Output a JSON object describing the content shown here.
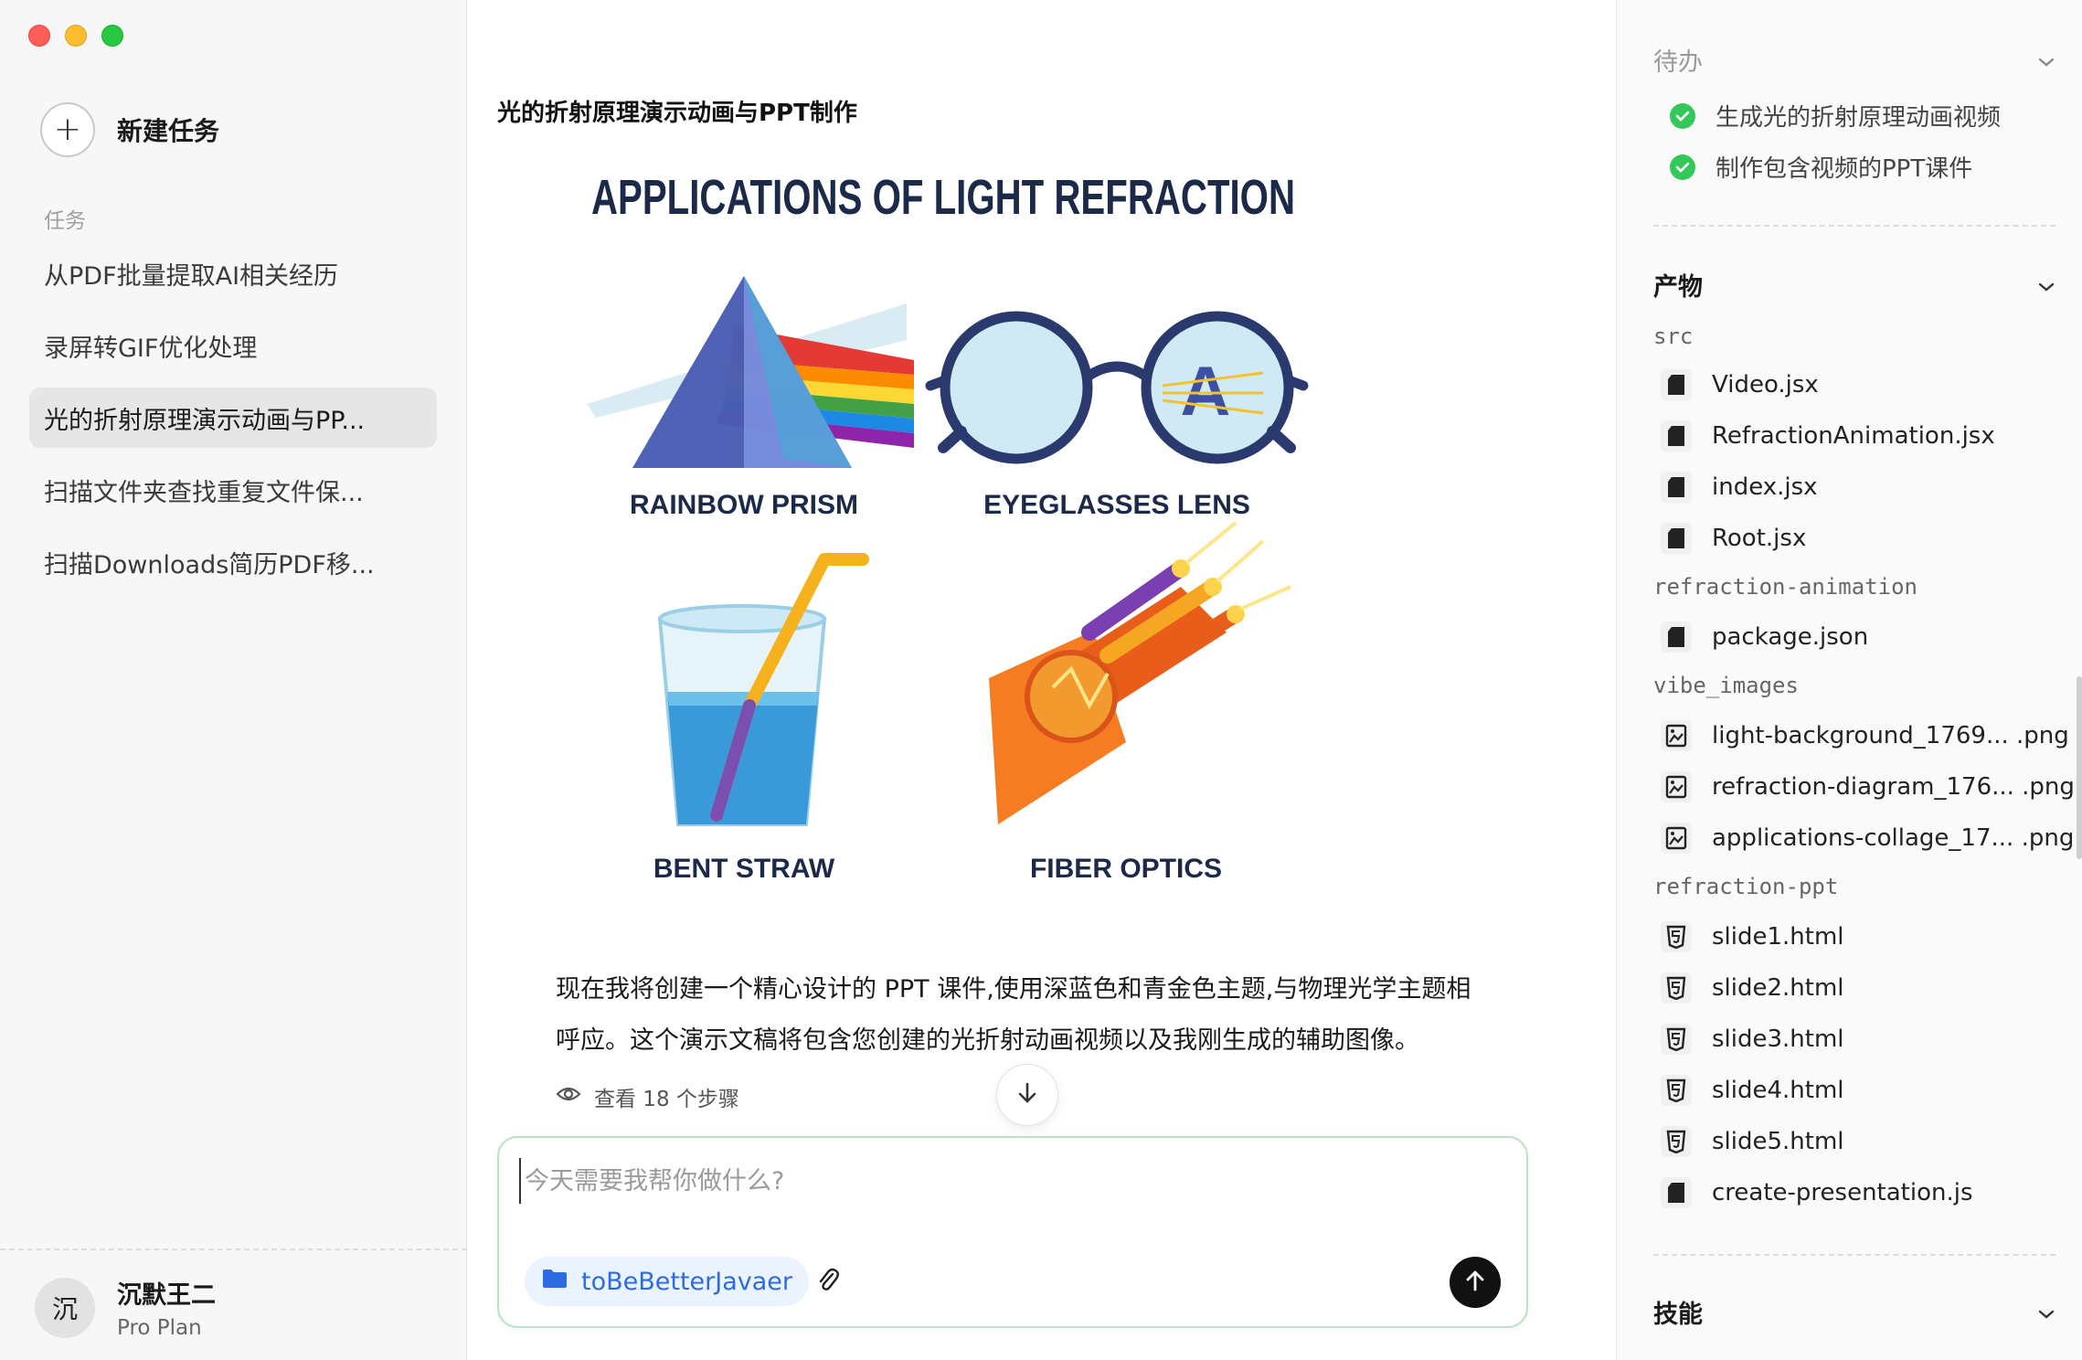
{
  "sidebar": {
    "new_task_label": "新建任务",
    "tasks_title": "任务",
    "tasks": [
      {
        "label": "从PDF批量提取AI相关经历"
      },
      {
        "label": "录屏转GIF优化处理"
      },
      {
        "label": "光的折射原理演示动画与PP..."
      },
      {
        "label": "扫描文件夹查找重复文件保..."
      },
      {
        "label": "扫描Downloads简历PDF移..."
      }
    ],
    "active_task_index": 2,
    "user": {
      "avatar_char": "沉",
      "name": "沉默王二",
      "plan": "Pro Plan"
    }
  },
  "main": {
    "title": "光的折射原理演示动画与PPT制作",
    "image": {
      "heading": "APPLICATIONS OF LIGHT REFRACTION",
      "labels": [
        "RAINBOW PRISM",
        "EYEGLASSES LENS",
        "BENT STRAW",
        "FIBER OPTICS"
      ]
    },
    "message_line1": "现在我将创建一个精心设计的 PPT 课件,使用深蓝色和青金色主题,与物理光学主题相",
    "message_line2": "呼应。这个演示文稿将包含您创建的光折射动画视频以及我刚生成的辅助图像。",
    "steps_label": "查看 18 个步骤",
    "composer": {
      "placeholder": "今天需要我帮你做什么?",
      "folder_label": "toBeBetterJavaer"
    }
  },
  "right_panel": {
    "todo": {
      "title": "待办",
      "items": [
        {
          "label": "生成光的折射原理动画视频"
        },
        {
          "label": "制作包含视频的PPT课件"
        }
      ]
    },
    "artifacts": {
      "title": "产物",
      "groups": [
        {
          "name": "src",
          "files": [
            "Video.jsx",
            "RefractionAnimation.jsx",
            "index.jsx",
            "Root.jsx"
          ]
        },
        {
          "name": "refraction-animation",
          "files": [
            "package.json"
          ]
        },
        {
          "name": "vibe_images",
          "files": [
            "light-background_1769... .png",
            "refraction-diagram_176... .png",
            "applications-collage_17... .png"
          ]
        },
        {
          "name": "refraction-ppt",
          "files": [
            "slide1.html",
            "slide2.html",
            "slide3.html",
            "slide4.html",
            "slide5.html",
            "create-presentation.js"
          ]
        }
      ]
    },
    "skills": {
      "title": "技能"
    }
  },
  "colors": {
    "accent_blue": "#2d6be0",
    "check_green": "#34c759",
    "composer_border": "#b8e3c4",
    "heading_navy": "#1c2a4a"
  },
  "icons": [
    "plus-icon",
    "eye-icon",
    "arrow-down-icon",
    "folder-icon",
    "paperclip-icon",
    "arrow-up-icon",
    "chevron-down-icon",
    "check-icon",
    "file-icon",
    "image-file-icon",
    "html5-icon"
  ]
}
